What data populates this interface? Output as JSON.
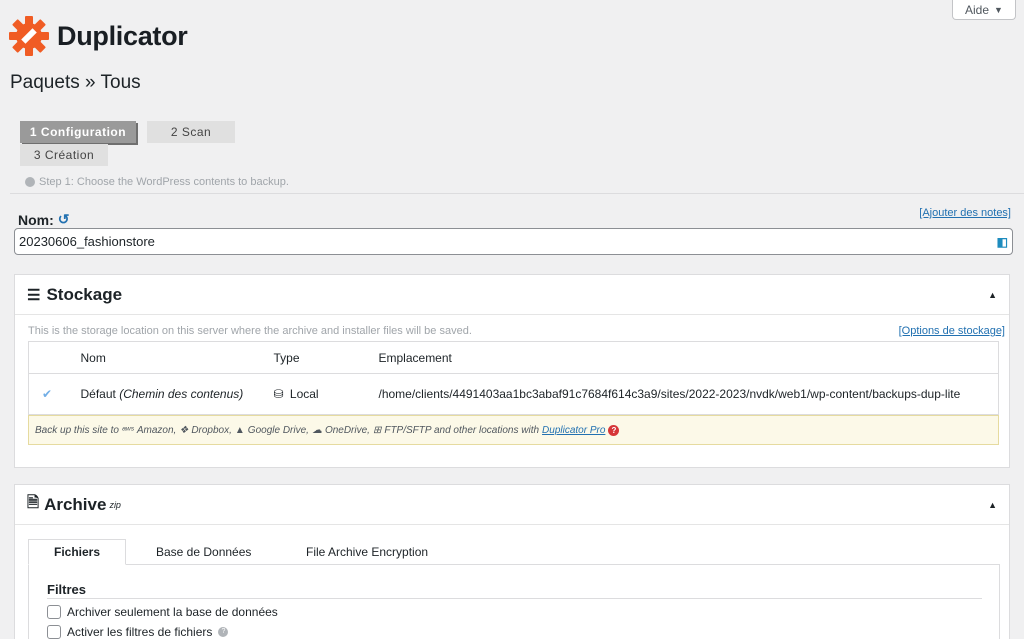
{
  "help": {
    "label": "Aide"
  },
  "brand": {
    "name": "Duplicator",
    "accent": "#f05c24"
  },
  "page": {
    "title": "Paquets » Tous"
  },
  "steps": [
    {
      "label": "1 Configuration"
    },
    {
      "label": "2 Scan"
    },
    {
      "label": "3 Création"
    }
  ],
  "step_hint": "Step 1: Choose the WordPress contents to backup.",
  "name_field": {
    "label": "Nom:",
    "value": "20230606_fashionstore",
    "add_notes": "[Ajouter des notes]"
  },
  "storage": {
    "title": "Stockage",
    "description": "This is the storage location on this server where the archive and installer files will be saved.",
    "options_link": "[Options de stockage]",
    "columns": [
      "Nom",
      "Type",
      "Emplacement"
    ],
    "row": {
      "name": "Défaut",
      "name_note": "(Chemin des contenus)",
      "type": "Local",
      "location": "/home/clients/4491403aa1bc3abaf91c7684f614c3a9/sites/2022-2023/nvdk/web1/wp-content/backups-dup-lite"
    },
    "promo": {
      "prefix": "Back up this site to",
      "amazon": "Amazon,",
      "dropbox": "Dropbox,",
      "gdrive": "Google Drive,",
      "onedrive": "OneDrive,",
      "ftp": "FTP/SFTP and other locations with",
      "pro_link": "Duplicator Pro"
    }
  },
  "archive": {
    "title": "Archive",
    "sup": "zip",
    "tabs": [
      "Fichiers",
      "Base de Données",
      "File Archive Encryption"
    ],
    "filters_title": "Filtres",
    "options": [
      "Archiver seulement la base de données",
      "Activer les filtres de fichiers"
    ]
  }
}
